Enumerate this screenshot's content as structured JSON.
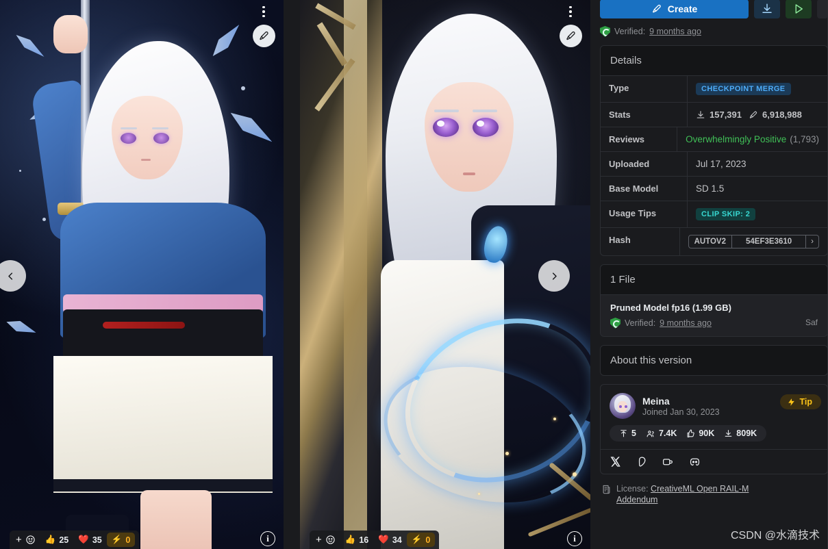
{
  "top_actions": {
    "create_label": "Create",
    "create_icon": "brush-icon",
    "download_icon": "download-icon",
    "run_icon": "play-icon"
  },
  "verified": {
    "label": "Verified:",
    "time": "9 months ago"
  },
  "details": {
    "title": "Details",
    "rows": [
      {
        "key": "Type",
        "value": "CHECKPOINT MERGE",
        "kind": "badge-type"
      },
      {
        "key": "Stats",
        "value": "",
        "kind": "stats",
        "downloads": "157,391",
        "generations": "6,918,988"
      },
      {
        "key": "Reviews",
        "value": "Overwhelmingly Positive",
        "count": "(1,793)",
        "kind": "reviews"
      },
      {
        "key": "Uploaded",
        "value": "Jul 17, 2023",
        "kind": "text"
      },
      {
        "key": "Base Model",
        "value": "SD 1.5",
        "kind": "text"
      },
      {
        "key": "Usage Tips",
        "value": "CLIP SKIP: 2",
        "kind": "badge-clip"
      },
      {
        "key": "Hash",
        "value": "54EF3E3610",
        "algo": "AUTOV2",
        "kind": "hash"
      }
    ]
  },
  "files": {
    "title": "1 File",
    "name": "Pruned Model fp16 (1.99 GB)",
    "verified_label": "Verified:",
    "verified_time": "9 months ago",
    "right_meta": "Saf"
  },
  "about": {
    "title": "About this version"
  },
  "creator": {
    "name": "Meina",
    "joined": "Joined Jan 30, 2023",
    "tip_label": "Tip",
    "stats": [
      {
        "icon": "upload-icon",
        "value": "5"
      },
      {
        "icon": "followers-icon",
        "value": "7.4K"
      },
      {
        "icon": "thumbs-up-icon",
        "value": "90K"
      },
      {
        "icon": "download-icon",
        "value": "809K"
      }
    ],
    "socials": [
      "x-icon",
      "patreon-icon",
      "coffee-icon",
      "discord-icon"
    ]
  },
  "license": {
    "label": "License:",
    "link": "CreativeML Open RAIL-M Addendum"
  },
  "watermark": "CSDN @水滴技术",
  "gallery": {
    "slides": [
      {
        "name": "image-1",
        "menu_icon": "more-vertical-icon",
        "remix_icon": "brush-icon",
        "info_icon": "info-icon",
        "reactions": [
          {
            "icon": "👍",
            "count": "25"
          },
          {
            "icon": "❤️",
            "count": "35"
          },
          {
            "icon": "⚡",
            "count": "0"
          }
        ]
      },
      {
        "name": "image-2",
        "menu_icon": "more-vertical-icon",
        "remix_icon": "brush-icon",
        "info_icon": "info-icon",
        "reactions": [
          {
            "icon": "👍",
            "count": "16"
          },
          {
            "icon": "❤️",
            "count": "34"
          },
          {
            "icon": "⚡",
            "count": "0"
          }
        ]
      }
    ],
    "prev_icon": "chevron-left-icon",
    "next_icon": "chevron-right-icon"
  },
  "colors": {
    "accent_blue": "#1971c2",
    "positive_green": "#40c057",
    "tip_orange": "#fcc419",
    "badge_blue": "#4dabf7",
    "badge_teal": "#38d9d2",
    "bg": "#1a1b1e"
  }
}
